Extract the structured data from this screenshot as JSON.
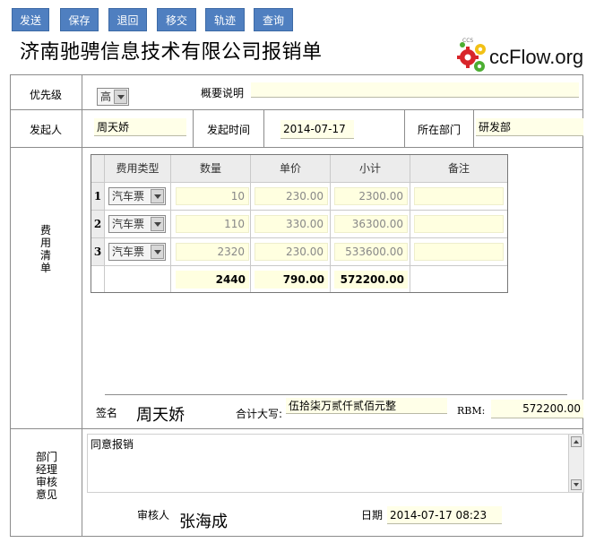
{
  "toolbar": {
    "send": "发送",
    "save": "保存",
    "return": "退回",
    "transfer": "移交",
    "track": "轨迹",
    "query": "查询"
  },
  "title": "济南驰骋信息技术有限公司报销单",
  "logo": {
    "text": "ccFlow.org",
    "small": "CCS"
  },
  "form": {
    "priority_label": "优先级",
    "priority_value": "高",
    "summary_label": "概要说明",
    "summary_value": "",
    "initiator_label": "发起人",
    "initiator_value": "周天娇",
    "start_time_label": "发起时间",
    "start_time_value": "2014-07-17",
    "dept_label": "所在部门",
    "dept_value": "研发部",
    "expense_section_label": [
      "费",
      "用",
      "清",
      "单"
    ]
  },
  "expense_table": {
    "headers": [
      "费用类型",
      "数量",
      "单价",
      "小计",
      "备注"
    ],
    "rows": [
      {
        "num": "1",
        "type": "汽车票",
        "qty": "10",
        "price": "230.00",
        "subtotal": "2300.00",
        "note": ""
      },
      {
        "num": "2",
        "type": "汽车票",
        "qty": "110",
        "price": "330.00",
        "subtotal": "36300.00",
        "note": ""
      },
      {
        "num": "3",
        "type": "汽车票",
        "qty": "2320",
        "price": "230.00",
        "subtotal": "533600.00",
        "note": ""
      }
    ],
    "totals": {
      "qty": "2440",
      "price": "790.00",
      "subtotal": "572200.00"
    }
  },
  "signature": {
    "sign_label": "签名",
    "sign_value": "周天娇",
    "total_caps_label": "合计大写:",
    "total_caps_value": "伍拾柒万贰仟贰佰元整",
    "rbm_label": "RBM:",
    "rbm_value": "572200.00"
  },
  "approval": {
    "section_label": [
      "部门",
      "经理",
      "审核",
      "意见"
    ],
    "opinion": "同意报销",
    "reviewer_label": "审核人",
    "reviewer_value": "张海成",
    "date_label": "日期",
    "date_value": "2014-07-17 08:23"
  },
  "colors": {
    "toolbar_button": "#4f7fc0",
    "input_bg": "#ffffe8"
  }
}
